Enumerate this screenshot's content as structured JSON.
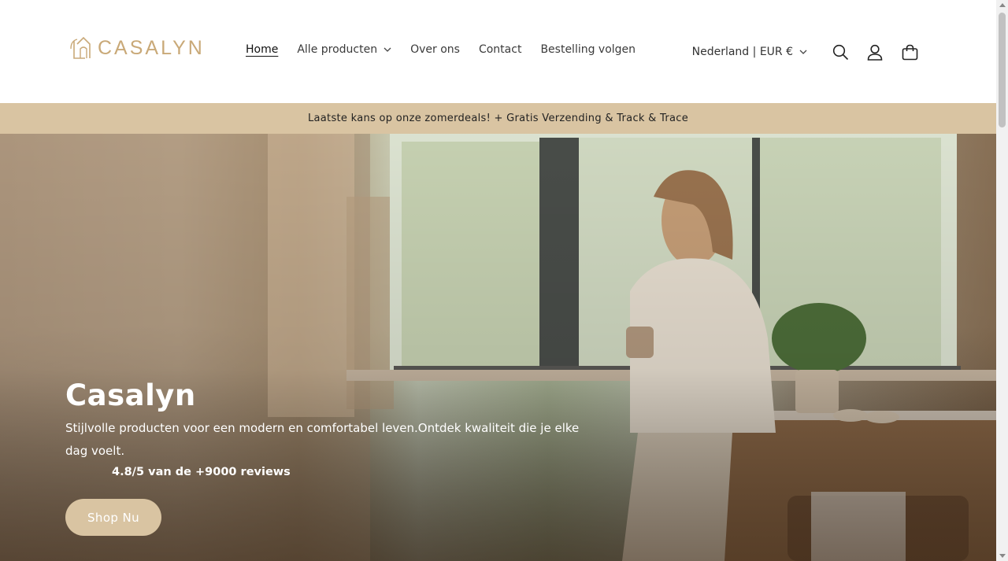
{
  "brand": {
    "name": "CASALYN",
    "accent_color": "#c9a978",
    "highlight_color": "#d9c4a2"
  },
  "nav": {
    "items": [
      {
        "label": "Home",
        "active": true
      },
      {
        "label": "Alle producten",
        "has_dropdown": true
      },
      {
        "label": "Over ons"
      },
      {
        "label": "Contact"
      },
      {
        "label": "Bestelling volgen"
      }
    ]
  },
  "tools": {
    "locale": "Nederland | EUR €",
    "icons": [
      "search-icon",
      "account-icon",
      "cart-icon"
    ]
  },
  "announcement": "Laatste kans op onze zomerdeals! + Gratis Verzending & Track & Trace",
  "hero": {
    "title": "Casalyn",
    "subtitle": "Stijlvolle producten voor een modern en comfortabel leven.Ontdek kwaliteit die je elke dag voelt.",
    "reviews": "4.8/5 van de +9000 reviews",
    "cta": "Shop Nu"
  }
}
